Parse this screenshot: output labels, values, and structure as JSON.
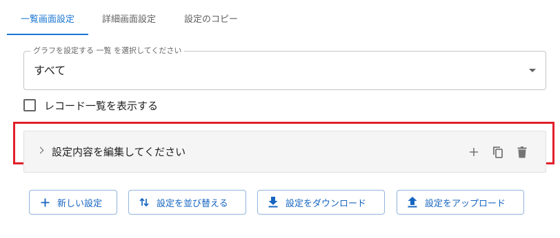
{
  "tabs": [
    {
      "label": "一覧画面設定",
      "active": true
    },
    {
      "label": "詳細画面設定",
      "active": false
    },
    {
      "label": "設定のコピー",
      "active": false
    }
  ],
  "select": {
    "legend": "グラフを設定する 一覧 を選択してください",
    "value": "すべて"
  },
  "checkbox": {
    "label": "レコード一覧を表示する",
    "checked": false
  },
  "accordion": {
    "title": "設定内容を編集してください",
    "icons": [
      "plus-icon",
      "copy-icon",
      "delete-icon"
    ]
  },
  "buttons": {
    "new": "新しい設定",
    "sort": "設定を並び替える",
    "download": "設定をダウンロード",
    "upload": "設定をアップロード"
  },
  "colors": {
    "accent": "#1976d2",
    "highlight": "#e0202a",
    "accordion_bg": "#f5f5f5"
  }
}
